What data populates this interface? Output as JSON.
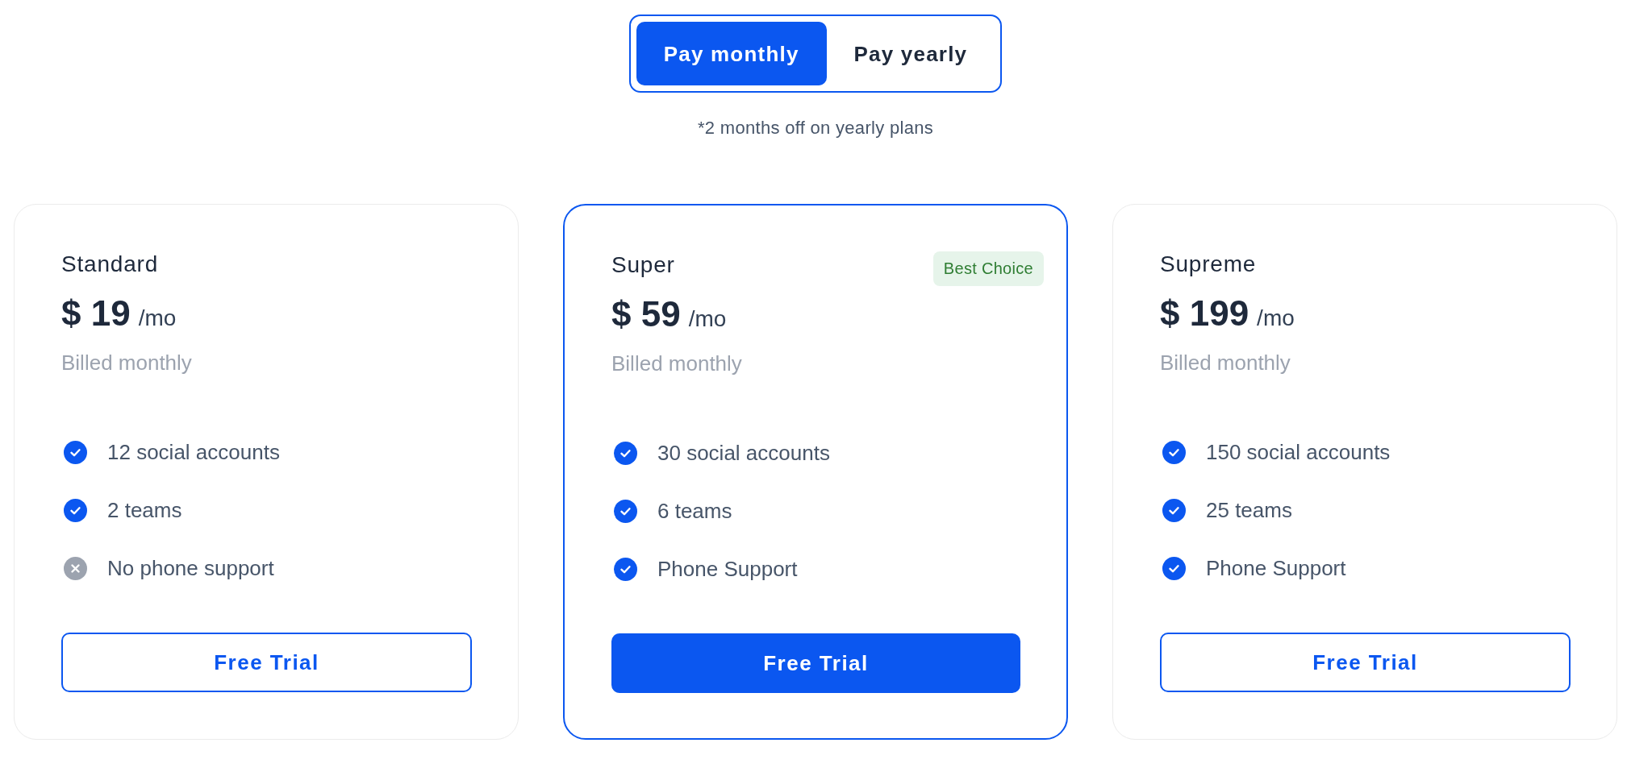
{
  "billing_toggle": {
    "options": [
      {
        "label": "Pay monthly",
        "selected": true
      },
      {
        "label": "Pay yearly",
        "selected": false
      }
    ]
  },
  "note": "*2 months off on yearly plans",
  "plans": [
    {
      "name": "Standard",
      "price": "$ 19",
      "period": "/mo",
      "billing": "Billed monthly",
      "highlighted": false,
      "features": [
        {
          "text": "12 social accounts",
          "included": true
        },
        {
          "text": "2 teams",
          "included": true
        },
        {
          "text": "No phone support",
          "included": false
        }
      ],
      "button": "Free Trial"
    },
    {
      "name": "Super",
      "badge": "Best Choice",
      "price": "$ 59",
      "period": "/mo",
      "billing": "Billed monthly",
      "highlighted": true,
      "features": [
        {
          "text": "30 social accounts",
          "included": true
        },
        {
          "text": "6 teams",
          "included": true
        },
        {
          "text": "Phone Support",
          "included": true
        }
      ],
      "button": "Free Trial"
    },
    {
      "name": "Supreme",
      "price": "$ 199",
      "period": "/mo",
      "billing": "Billed monthly",
      "highlighted": false,
      "features": [
        {
          "text": "150 social accounts",
          "included": true
        },
        {
          "text": "25 teams",
          "included": true
        },
        {
          "text": "Phone Support",
          "included": true
        }
      ],
      "button": "Free Trial"
    }
  ]
}
